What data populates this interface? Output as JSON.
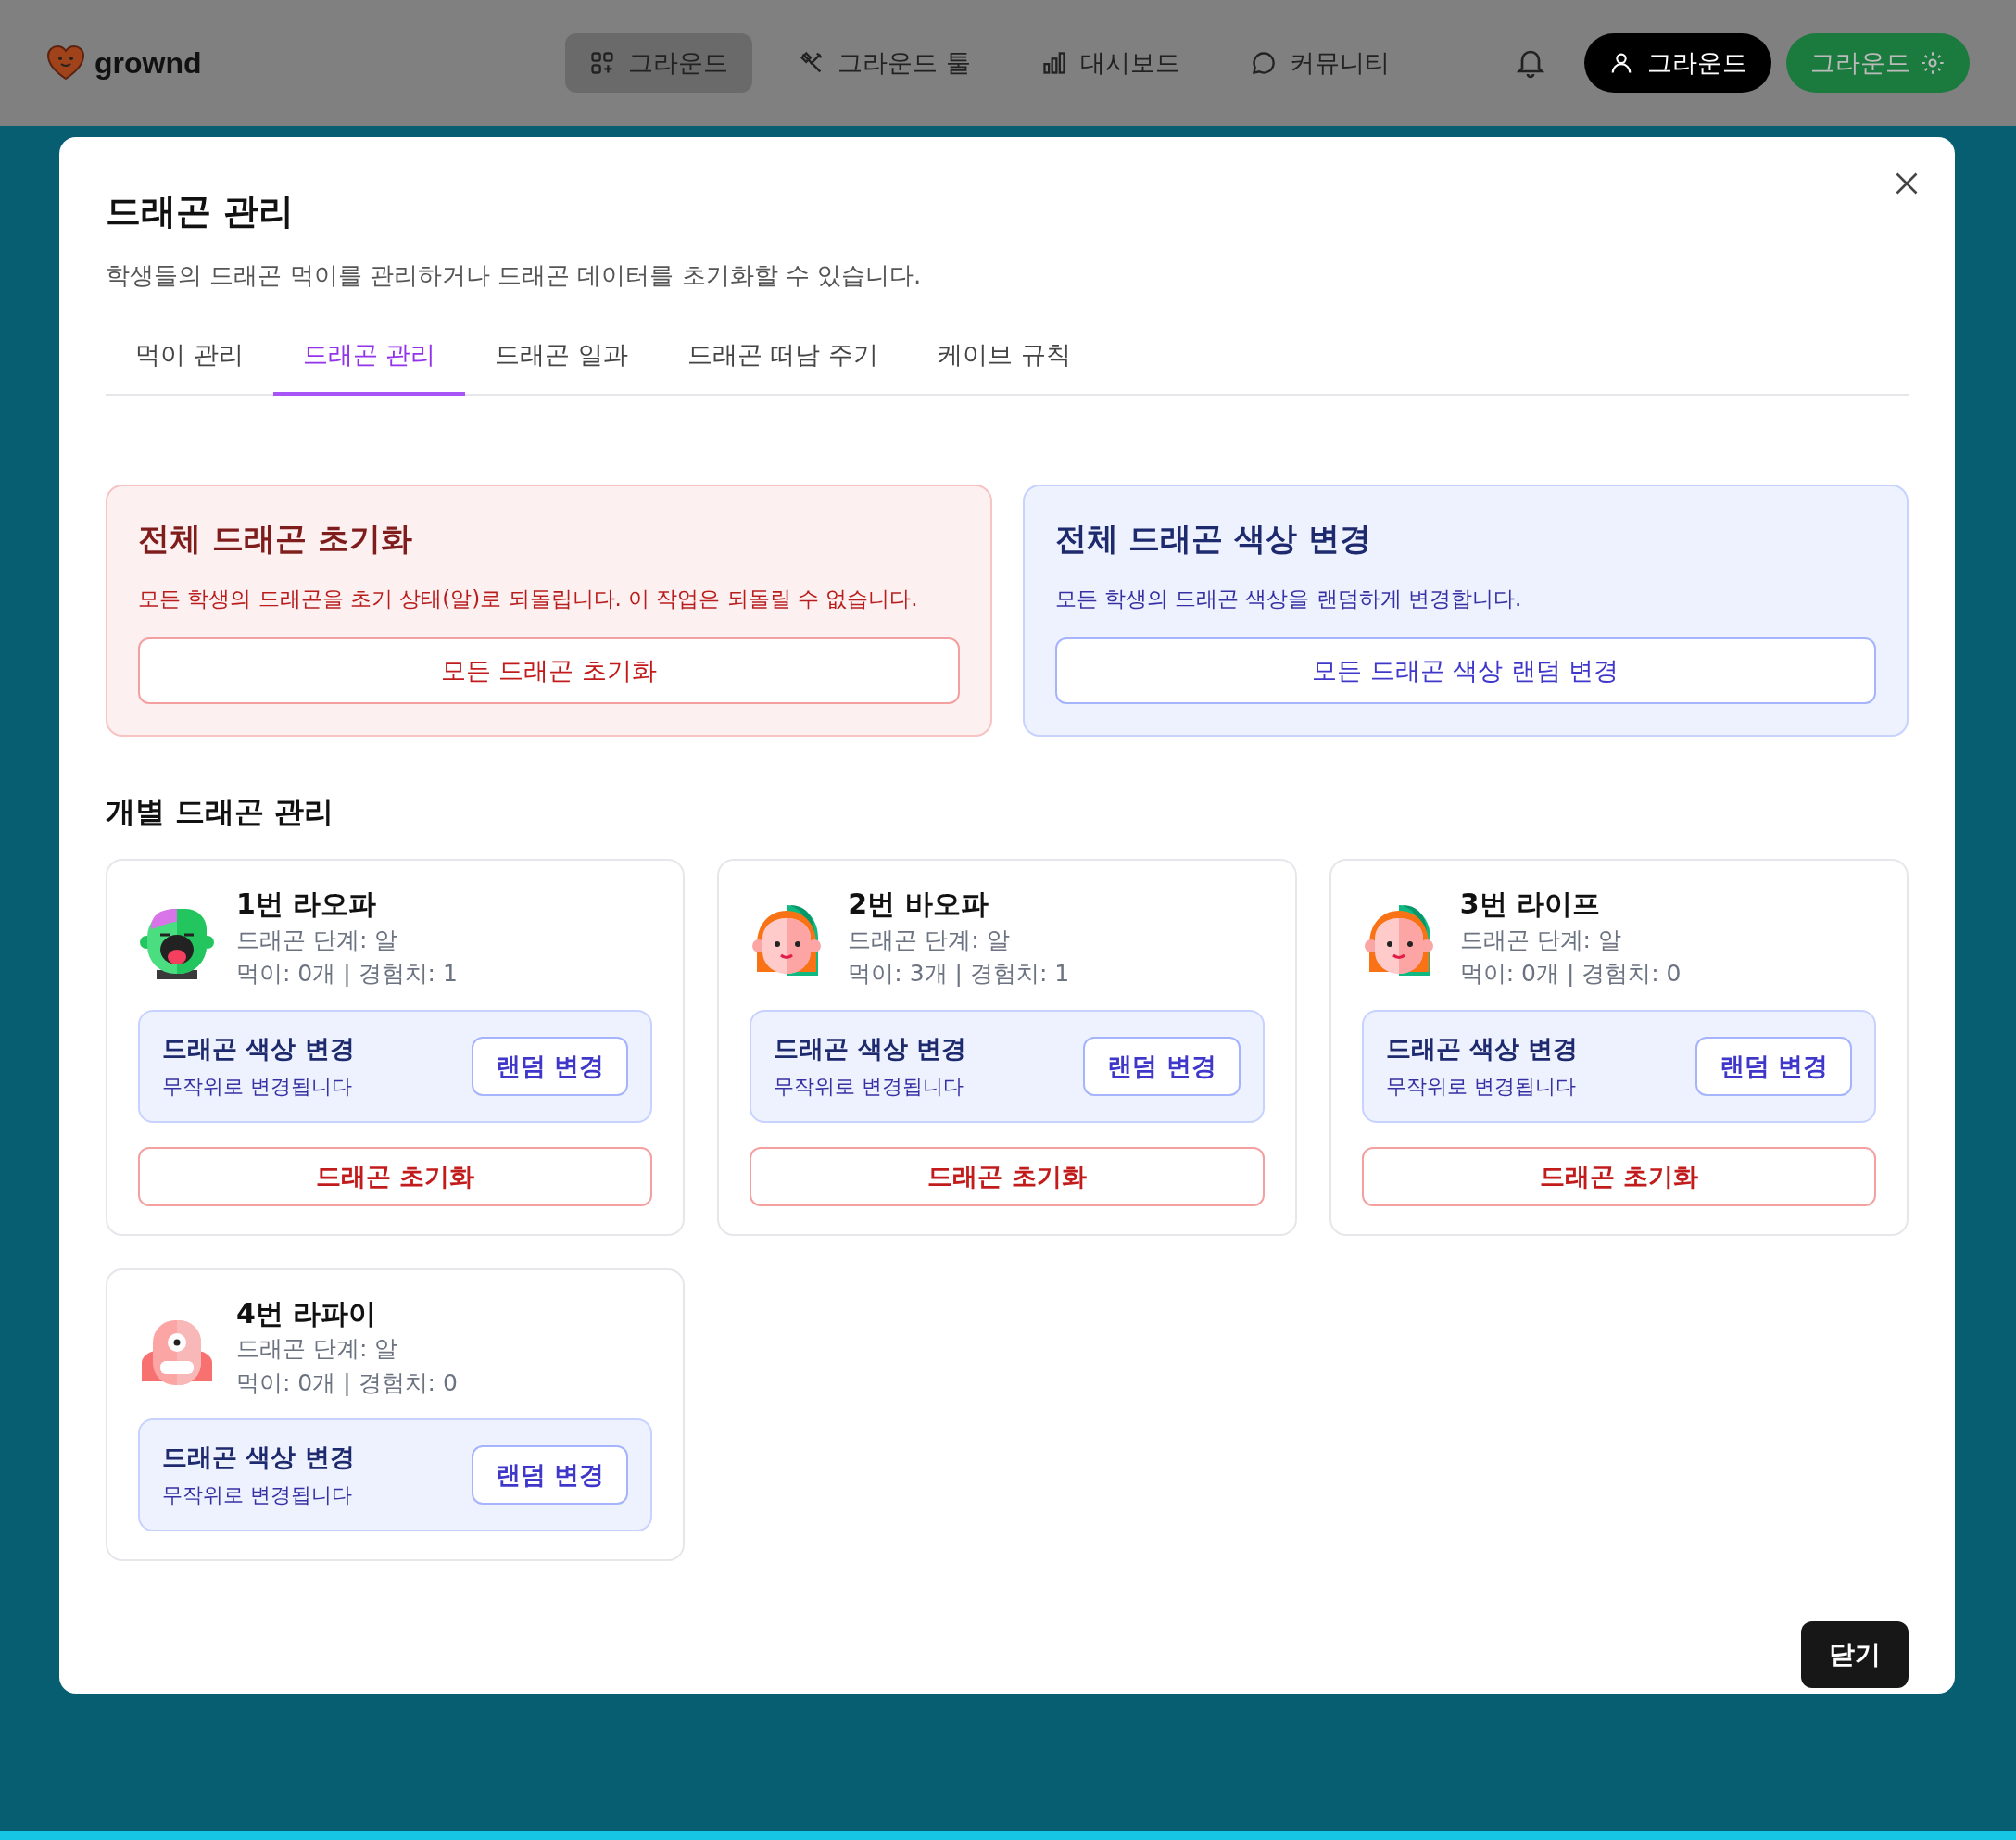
{
  "header": {
    "logo": "grownd",
    "nav": [
      {
        "label": "그라운드",
        "selected": true
      },
      {
        "label": "그라운드 툴",
        "selected": false
      },
      {
        "label": "대시보드",
        "selected": false
      },
      {
        "label": "커뮤니티",
        "selected": false
      }
    ],
    "user_button": "그라운드",
    "settings_button": "그라운드"
  },
  "modal": {
    "title": "드래곤 관리",
    "description": "학생들의 드래곤 먹이를 관리하거나 드래곤 데이터를 초기화할 수 있습니다.",
    "tabs": [
      {
        "label": "먹이 관리",
        "selected": false
      },
      {
        "label": "드래곤 관리",
        "selected": true
      },
      {
        "label": "드래곤 일과",
        "selected": false
      },
      {
        "label": "드래곤 떠남 주기",
        "selected": false
      },
      {
        "label": "케이브 규칙",
        "selected": false
      }
    ],
    "bulk_actions": [
      {
        "kind": "danger",
        "title": "전체 드래곤 초기화",
        "text": "모든 학생의 드래곤을 초기 상태(알)로 되돌립니다. 이 작업은 되돌릴 수 없습니다.",
        "button": "모든 드래곤 초기화"
      },
      {
        "kind": "info",
        "title": "전체 드래곤 색상 변경",
        "text": "모든 학생의 드래곤 색상을 랜덤하게 변경합니다.",
        "button": "모든 드래곤 색상 랜덤 변경"
      }
    ],
    "section_title": "개별 드래곤 관리",
    "dragons": [
      {
        "name": "1번 라오파",
        "stage": "드래곤 단계: 알",
        "stats": "먹이: 0개 | 경험치: 1",
        "color_title": "드래곤 색상 변경",
        "color_note": "무작위로 변경됩니다",
        "random_button": "랜덤 변경",
        "reset_button": "드래곤 초기화"
      },
      {
        "name": "2번 바오파",
        "stage": "드래곤 단계: 알",
        "stats": "먹이: 3개 | 경험치: 1",
        "color_title": "드래곤 색상 변경",
        "color_note": "무작위로 변경됩니다",
        "random_button": "랜덤 변경",
        "reset_button": "드래곤 초기화"
      },
      {
        "name": "3번 라이프",
        "stage": "드래곤 단계: 알",
        "stats": "먹이: 0개 | 경험치: 0",
        "color_title": "드래곤 색상 변경",
        "color_note": "무작위로 변경됩니다",
        "random_button": "랜덤 변경",
        "reset_button": "드래곤 초기화"
      },
      {
        "name": "4번 라파이",
        "stage": "드래곤 단계: 알",
        "stats": "먹이: 0개 | 경험치: 0",
        "color_title": "드래곤 색상 변경",
        "color_note": "무작위로 변경됩니다",
        "random_button": "랜덤 변경"
      }
    ],
    "close_button": "닫기"
  }
}
